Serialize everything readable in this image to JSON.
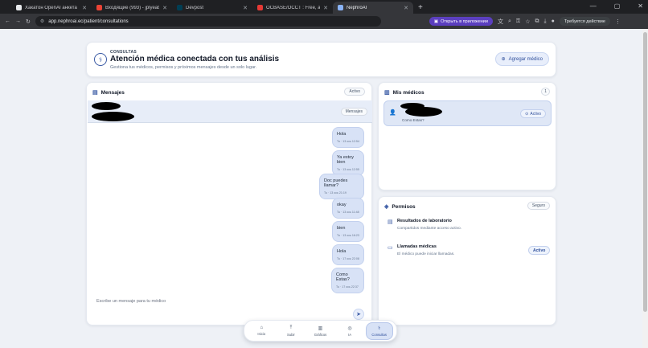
{
  "browser": {
    "tabs": [
      {
        "title": "Хакатон OpenAI анкета",
        "color": "#e8eaed"
      },
      {
        "title": "Входящие (993) - jplyeab@gm",
        "color": "#ea4335"
      },
      {
        "title": "Devpost",
        "color": "#003e54"
      },
      {
        "title": "OCBASE/OCCT : Free, all-in-one",
        "color": "#e53935"
      },
      {
        "title": "NephroAI",
        "color": "#8ab4f8"
      }
    ],
    "url": "app.nephroai.ec/patient/consultations",
    "open_in_app": "Открыть в приложении",
    "action_required": "Требуется действие"
  },
  "header": {
    "kicker": "CONSULTAS",
    "title": "Atención médica conectada con tus análisis",
    "subtitle": "Gestiona tus médicos, permisos y próximos mensajes desde un solo lugar.",
    "add_doctor": "Agregar médico"
  },
  "messages_panel": {
    "title": "Mensajes",
    "status": "Activo",
    "chat_badge": "Mensajes",
    "bubbles": [
      {
        "text": "Hola",
        "time": "Tu · 13 ось 12:54"
      },
      {
        "text": "Ya estoy bien",
        "time": "Tu · 13 ось 12:55"
      },
      {
        "text": "Doc puedes llamar?",
        "time": "Tu · 13 ось 21:19"
      },
      {
        "text": "okay",
        "time": "Tu · 13 ось 11:48"
      },
      {
        "text": "bien",
        "time": "Tu · 13 ось 16:23"
      },
      {
        "text": "Hola",
        "time": "Tu · 17 ось 22:08"
      },
      {
        "text": "Como Estas?",
        "time": "Tu · 17 ось 22:37"
      }
    ],
    "composer_placeholder": "Escribe un mensaje para tu médico"
  },
  "doctors_panel": {
    "title": "Mis médicos",
    "count": "1",
    "doctor_last_message": "Como Estas?",
    "doctor_status": "Activo"
  },
  "permissions_panel": {
    "title": "Permisos",
    "badge": "Seguro",
    "items": [
      {
        "title": "Resultados de laboratorio",
        "desc": "Compartidos mediante acceso activo."
      },
      {
        "title": "Llamadas médicas",
        "desc": "El médico puede iniciar llamadas.",
        "status": "Activo"
      }
    ]
  },
  "bottom_nav": [
    {
      "label": "Inicio",
      "icon": "home-icon"
    },
    {
      "label": "Subir",
      "icon": "upload-icon"
    },
    {
      "label": "Gráficos",
      "icon": "chart-icon"
    },
    {
      "label": "IA",
      "icon": "ai-icon"
    },
    {
      "label": "Consultas",
      "icon": "consult-icon",
      "active": true
    }
  ]
}
